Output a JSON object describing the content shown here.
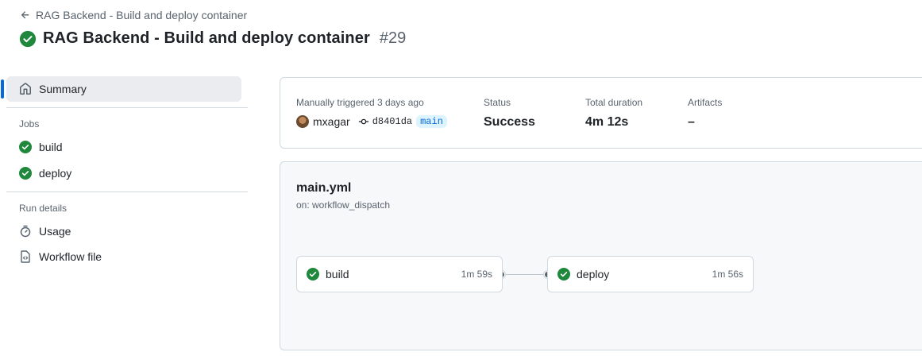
{
  "breadcrumb": {
    "back_label": "RAG Backend - Build and deploy container"
  },
  "header": {
    "title": "RAG Backend - Build and deploy container",
    "run_number": "#29",
    "status": "success"
  },
  "sidebar": {
    "summary_label": "Summary",
    "jobs_heading": "Jobs",
    "jobs": [
      {
        "label": "build",
        "status": "success"
      },
      {
        "label": "deploy",
        "status": "success"
      }
    ],
    "run_details_heading": "Run details",
    "usage_label": "Usage",
    "workflow_file_label": "Workflow file"
  },
  "summary": {
    "trigger_label": "Manually triggered 3 days ago",
    "actor": "mxagar",
    "commit_sha": "d8401da",
    "branch": "main",
    "status_label": "Status",
    "status_value": "Success",
    "duration_label": "Total duration",
    "duration_value": "4m 12s",
    "artifacts_label": "Artifacts",
    "artifacts_value": "–"
  },
  "graph": {
    "workflow_file": "main.yml",
    "trigger": "on: workflow_dispatch",
    "jobs": [
      {
        "name": "build",
        "duration": "1m 59s"
      },
      {
        "name": "deploy",
        "duration": "1m 56s"
      }
    ]
  },
  "colors": {
    "success": "#1f883d",
    "accent": "#0969da",
    "muted": "#59636e"
  }
}
